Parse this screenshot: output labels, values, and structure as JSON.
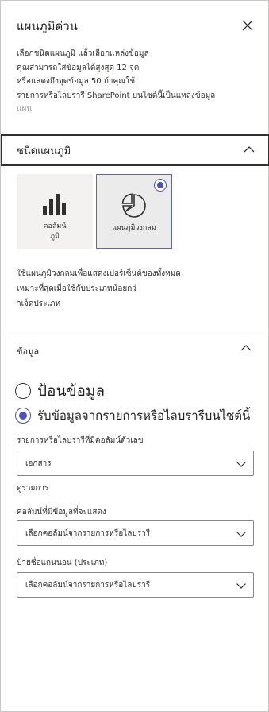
{
  "pane": {
    "title": "แผนภูมิด่วน",
    "intro_lines": [
      "เลือกชนิดแผนภูมิ แล้วเลือกแหล่งข้อมูล",
      "คุณสามารถใส่ข้อมูลได้สูงสุด 12 จุด",
      "หรือแสดงถึงจุดข้อมูล 50 ถ้าคุณใช้",
      "รายการหรือไลบรารี SharePoint บนไซต์นี้เป็นแหล่งข้อมูล",
      "แผน"
    ]
  },
  "chart_type_section": {
    "header": "ชนิดแผนภูมิ",
    "tiles": [
      {
        "label_line1": "คอลัมน์",
        "label_line2": "ภูมิ",
        "selected": false,
        "icon": "column-chart-icon"
      },
      {
        "label_line1": "แผนภูมิวงกลม",
        "label_line2": "",
        "selected": true,
        "icon": "pie-chart-icon"
      }
    ],
    "description_lines": [
      "ใช้แผนภูมิวงกลมเพื่อแสดงเปอร์เซ็นต์ของทั้งหมด",
      "เหมาะที่สุดเมื่อใช้กับประเภทน้อยกว่",
      "าเจ็ดประเภท"
    ]
  },
  "data_section": {
    "header": "ข้อมูล",
    "options": [
      {
        "label": "ป้อนข้อมูล",
        "selected": false
      },
      {
        "label": "รับข้อมูลจากรายการหรือไลบรารีบนไซต์นี้",
        "selected": true
      }
    ],
    "list_label": "รายการหรือไลบรารีที่มีคอลัมน์ตัวเลข",
    "list_value": "เอกสาร",
    "view_list_link": "ดูรายการ",
    "data_column_label": "คอลัมน์ที่มีข้อมูลที่จะแสดง",
    "data_column_value": "เลือกคอลัมน์จากรายการหรือไลบรารี",
    "axis_label": "ป้ายชื่อแกนนอน (ประเภท)",
    "axis_value": "เลือกคอลัมน์จากรายการหรือไลบรารี"
  },
  "colors": {
    "accent": "#4f52b2",
    "tile_bg": "#f3f2f1",
    "text": "#323130"
  }
}
